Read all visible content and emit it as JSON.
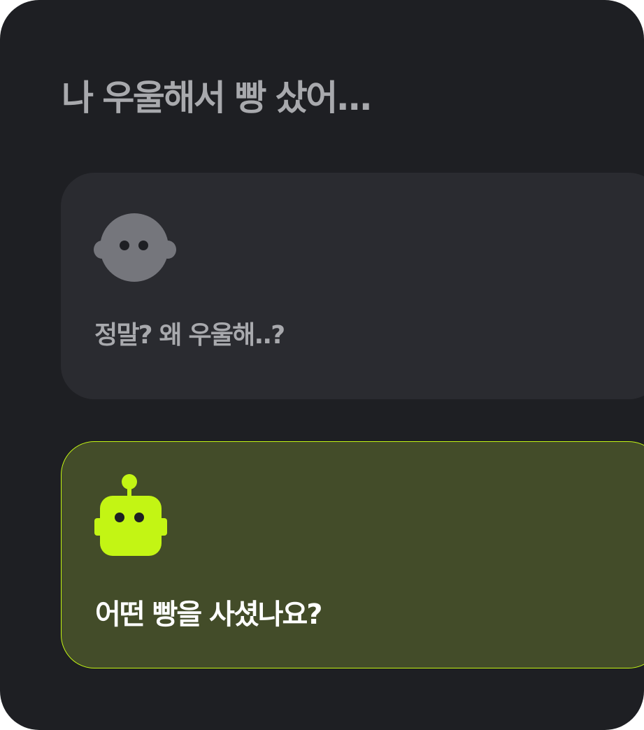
{
  "chat": {
    "prompt": "나 우울해서 빵 샀어...",
    "messages": [
      {
        "sender": "user",
        "avatar_icon": "user-face-icon",
        "text": "정말? 왜 우울해..?"
      },
      {
        "sender": "bot",
        "avatar_icon": "robot-icon",
        "text": "어떤 빵을 사셨나요?"
      }
    ]
  },
  "colors": {
    "background": "#1e1f23",
    "user_bubble": "#2a2b30",
    "bot_bubble": "#434c29",
    "accent": "#c3f514"
  }
}
